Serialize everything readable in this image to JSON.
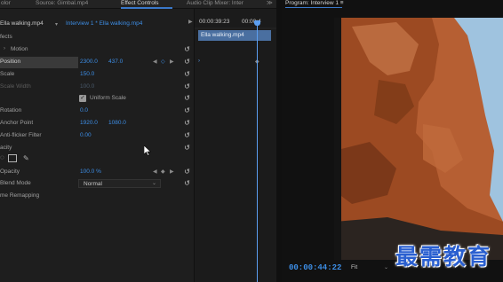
{
  "tabs": {
    "first": "olor",
    "source": "Source: Gimbal.mp4",
    "effect_controls": "Effect Controls",
    "audio_mixer": "Audio Clip Mixer: Inter",
    "more": "≫",
    "program": "Program: Interview 1 ≡"
  },
  "effect_controls": {
    "master_clip": "Ella walking.mp4",
    "sequence_clip": "Interview 1 * Ella walking.mp4",
    "timecode": "00:00:39:23",
    "timecode_end": "00:00:4",
    "section_fx": "fects",
    "motion_label": "Motion",
    "position_label": "Position",
    "position_x": "2300.0",
    "position_y": "437.0",
    "scale_label": "Scale",
    "scale_value": "150.0",
    "scale_width_label": "Scale Width",
    "scale_width_value": "100.0",
    "uniform_scale_label": "Uniform Scale",
    "uniform_scale_checked": true,
    "rotation_label": "Rotation",
    "rotation_value": "0.0",
    "anchor_label": "Anchor Point",
    "anchor_x": "1920.0",
    "anchor_y": "1080.0",
    "antiflicker_label": "Anti-flicker Filter",
    "antiflicker_value": "0.00",
    "opacity_section_label": "acity",
    "opacity_label": "Opacity",
    "opacity_value": "100.0 %",
    "blend_label": "Blend Mode",
    "blend_value": "Normal",
    "remap_label": "me Remapping"
  },
  "timeline": {
    "clip_label": "Ella walking.mp4"
  },
  "program": {
    "timecode": "00:00:44:22",
    "zoom": "Fit",
    "watermark": "最需教育"
  },
  "icons": {
    "reset": "reset-icon",
    "keyframe": "keyframe-icon",
    "rectangle_mask": "rectangle-mask-icon",
    "pen_mask": "pen-mask-icon",
    "cursor": "mouse-cursor-icon"
  },
  "colors": {
    "accent_blue": "#3d8ee6",
    "clip_blue": "#4a6fa0",
    "watermark_blue": "#2a5fd0"
  }
}
